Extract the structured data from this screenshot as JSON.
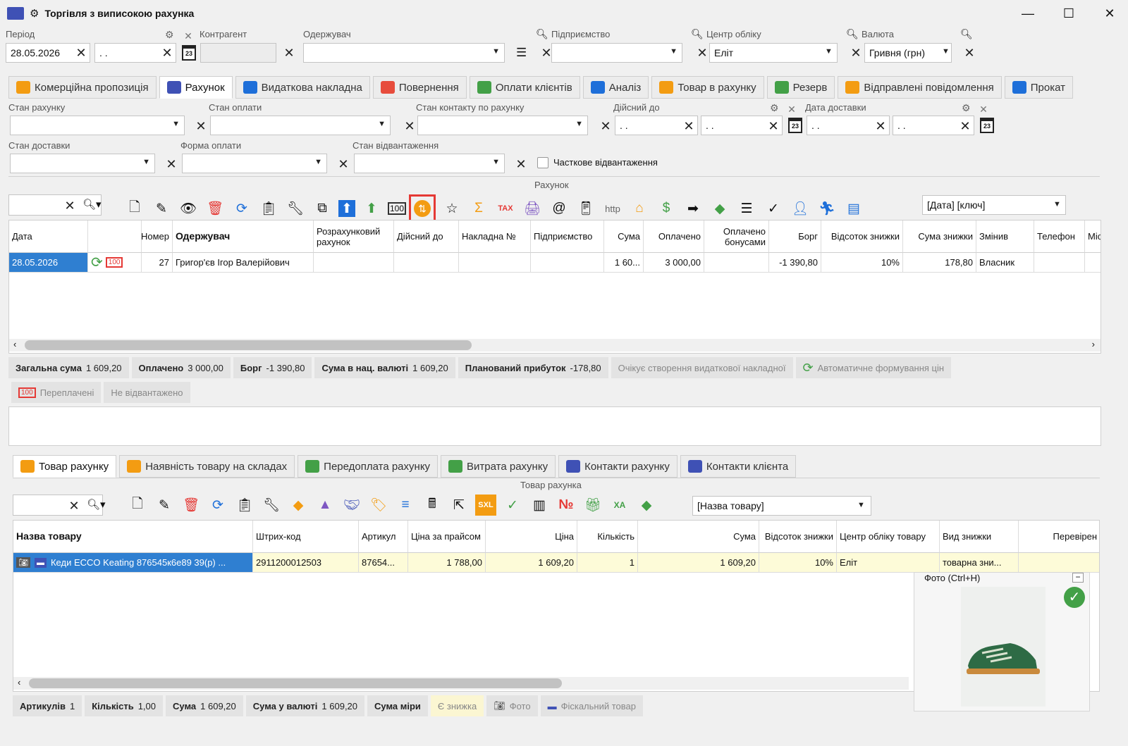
{
  "window": {
    "title": "Торгівля з виписокою рахунка",
    "minimize": "—",
    "maximize": "☐",
    "close": "✕"
  },
  "filters": {
    "period_label": "Період",
    "period_from": "28.05.2026",
    "period_to": ". .",
    "counterparty_label": "Контрагент",
    "recipient_label": "Одержувач",
    "enterprise_label": "Підприємство",
    "center_label": "Центр обліку",
    "center_value": "Еліт",
    "currency_label": "Валюта",
    "currency_value": "Гривня (грн)"
  },
  "top_tabs": [
    {
      "label": "Комерційна пропозиція",
      "color": "#f39c12"
    },
    {
      "label": "Рахунок",
      "color": "#3f51b5"
    },
    {
      "label": "Видаткова накладна",
      "color": "#1e6fd9"
    },
    {
      "label": "Повернення",
      "color": "#e74c3c"
    },
    {
      "label": "Оплати клієнтів",
      "color": "#43a047"
    },
    {
      "label": "Аналіз",
      "color": "#1e6fd9"
    },
    {
      "label": "Товар в рахунку",
      "color": "#f39c12"
    },
    {
      "label": "Резерв",
      "color": "#43a047"
    },
    {
      "label": "Відправлені повідомлення",
      "color": "#f39c12"
    },
    {
      "label": "Прокат",
      "color": "#1e6fd9"
    }
  ],
  "invoice_filters": {
    "invoice_state": "Стан рахунку",
    "payment_state": "Стан оплати",
    "contact_state": "Стан контакту по рахунку",
    "valid_to": "Дійсний до",
    "delivery_date": "Дата доставки",
    "empty_date": ". .",
    "delivery_state": "Стан доставки",
    "payment_form": "Форма оплати",
    "shipment_state": "Стан відвантаження",
    "partial": "Часткове відвантаження"
  },
  "invoice_section": {
    "title": "Рахунок",
    "sort_value": "[Дата]  [ключ]"
  },
  "invoice_grid": {
    "headers": [
      "Дата",
      "",
      "Номер",
      "Одержувач",
      "Розрахунковий рахунок",
      "Дійсний до",
      "Накладна №",
      "Підприємство",
      "Сума",
      "Оплачено",
      "Оплачено бонусами",
      "Борг",
      "Відсоток знижки",
      "Сума знижки",
      "Змінив",
      "Телефон",
      "Міс"
    ],
    "row": {
      "date": "28.05.2026",
      "num": "27",
      "recipient": "Григор'єв Ігор Валерійович",
      "sum": "1 60...",
      "paid": "3 000,00",
      "debt": "-1 390,80",
      "disc_pct": "10%",
      "disc_sum": "178,80",
      "changed": "Власник"
    }
  },
  "invoice_status": {
    "total_label": "Загальна сума",
    "total": "1 609,20",
    "paid_label": "Оплачено",
    "paid": "3 000,00",
    "debt_label": "Борг",
    "debt": "-1 390,80",
    "nat_label": "Сума в нац. валюті",
    "nat": "1 609,20",
    "profit_label": "Планований прибуток",
    "profit": "-178,80",
    "waiting": "Очікує створення видаткової накладної",
    "auto": "Автоматичне формування цін",
    "overpaid": "Переплачені",
    "not_shipped": "Не відвантажено"
  },
  "bottom_tabs": [
    {
      "label": "Товар рахунку",
      "color": "#f39c12"
    },
    {
      "label": "Наявність товару на складах",
      "color": "#f39c12"
    },
    {
      "label": "Передоплата рахунку",
      "color": "#43a047"
    },
    {
      "label": "Витрата рахунку",
      "color": "#43a047"
    },
    {
      "label": "Контакти рахунку",
      "color": "#3f51b5"
    },
    {
      "label": "Контакти клієнта",
      "color": "#3f51b5"
    }
  ],
  "goods_section": {
    "title": "Товар рахунка",
    "sort_value": "[Назва товару]"
  },
  "goods_grid": {
    "headers": [
      "Назва товару",
      "Штрих-код",
      "Артикул",
      "Ціна за прайсом",
      "Ціна",
      "Кількість",
      "Сума",
      "Відсоток знижки",
      "Центр обліку товару",
      "Вид знижки",
      "Перевірен"
    ],
    "row": {
      "name": "Кеди ECCO Keating 876545к6е89 39(р) ...",
      "barcode": "2911200012503",
      "article": "87654...",
      "price_list": "1 788,00",
      "price": "1 609,20",
      "qty": "1",
      "sum": "1 609,20",
      "disc_pct": "10%",
      "center": "Еліт",
      "disc_type": "товарна зни..."
    }
  },
  "photo": {
    "title": "Фото (Ctrl+H)"
  },
  "goods_status": {
    "articles_label": "Артикулів",
    "articles": "1",
    "qty_label": "Кількість",
    "qty": "1,00",
    "sum_label": "Сума",
    "sum": "1 609,20",
    "cur_label": "Сума у валюті",
    "cur": "1 609,20",
    "measure_label": "Сума міри",
    "discount": "Є знижка",
    "photo": "Фото",
    "fiscal": "Фіскальний товар"
  }
}
